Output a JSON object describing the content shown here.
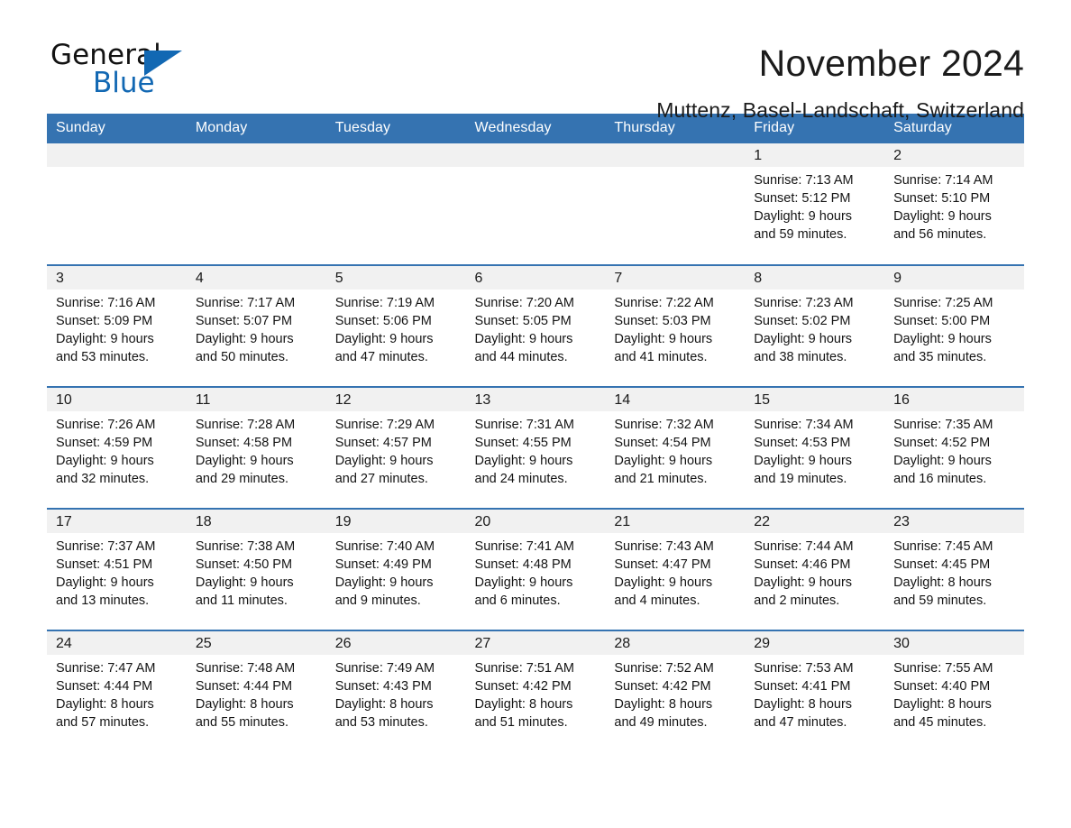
{
  "logo": {
    "word1": "General",
    "word2": "Blue",
    "triangle_color": "#1268b3"
  },
  "header": {
    "month_title": "November 2024",
    "location": "Muttenz, Basel-Landschaft, Switzerland"
  },
  "theme": {
    "header_blue": "#3573b1",
    "daynum_band": "#f1f1f1",
    "text": "#141414"
  },
  "calendar": {
    "weekday_headers": [
      "Sunday",
      "Monday",
      "Tuesday",
      "Wednesday",
      "Thursday",
      "Friday",
      "Saturday"
    ],
    "weeks": [
      [
        {
          "day": "",
          "sunrise": "",
          "sunset": "",
          "daylight_line1": "",
          "daylight_line2": ""
        },
        {
          "day": "",
          "sunrise": "",
          "sunset": "",
          "daylight_line1": "",
          "daylight_line2": ""
        },
        {
          "day": "",
          "sunrise": "",
          "sunset": "",
          "daylight_line1": "",
          "daylight_line2": ""
        },
        {
          "day": "",
          "sunrise": "",
          "sunset": "",
          "daylight_line1": "",
          "daylight_line2": ""
        },
        {
          "day": "",
          "sunrise": "",
          "sunset": "",
          "daylight_line1": "",
          "daylight_line2": ""
        },
        {
          "day": "1",
          "sunrise": "Sunrise: 7:13 AM",
          "sunset": "Sunset: 5:12 PM",
          "daylight_line1": "Daylight: 9 hours",
          "daylight_line2": "and 59 minutes."
        },
        {
          "day": "2",
          "sunrise": "Sunrise: 7:14 AM",
          "sunset": "Sunset: 5:10 PM",
          "daylight_line1": "Daylight: 9 hours",
          "daylight_line2": "and 56 minutes."
        }
      ],
      [
        {
          "day": "3",
          "sunrise": "Sunrise: 7:16 AM",
          "sunset": "Sunset: 5:09 PM",
          "daylight_line1": "Daylight: 9 hours",
          "daylight_line2": "and 53 minutes."
        },
        {
          "day": "4",
          "sunrise": "Sunrise: 7:17 AM",
          "sunset": "Sunset: 5:07 PM",
          "daylight_line1": "Daylight: 9 hours",
          "daylight_line2": "and 50 minutes."
        },
        {
          "day": "5",
          "sunrise": "Sunrise: 7:19 AM",
          "sunset": "Sunset: 5:06 PM",
          "daylight_line1": "Daylight: 9 hours",
          "daylight_line2": "and 47 minutes."
        },
        {
          "day": "6",
          "sunrise": "Sunrise: 7:20 AM",
          "sunset": "Sunset: 5:05 PM",
          "daylight_line1": "Daylight: 9 hours",
          "daylight_line2": "and 44 minutes."
        },
        {
          "day": "7",
          "sunrise": "Sunrise: 7:22 AM",
          "sunset": "Sunset: 5:03 PM",
          "daylight_line1": "Daylight: 9 hours",
          "daylight_line2": "and 41 minutes."
        },
        {
          "day": "8",
          "sunrise": "Sunrise: 7:23 AM",
          "sunset": "Sunset: 5:02 PM",
          "daylight_line1": "Daylight: 9 hours",
          "daylight_line2": "and 38 minutes."
        },
        {
          "day": "9",
          "sunrise": "Sunrise: 7:25 AM",
          "sunset": "Sunset: 5:00 PM",
          "daylight_line1": "Daylight: 9 hours",
          "daylight_line2": "and 35 minutes."
        }
      ],
      [
        {
          "day": "10",
          "sunrise": "Sunrise: 7:26 AM",
          "sunset": "Sunset: 4:59 PM",
          "daylight_line1": "Daylight: 9 hours",
          "daylight_line2": "and 32 minutes."
        },
        {
          "day": "11",
          "sunrise": "Sunrise: 7:28 AM",
          "sunset": "Sunset: 4:58 PM",
          "daylight_line1": "Daylight: 9 hours",
          "daylight_line2": "and 29 minutes."
        },
        {
          "day": "12",
          "sunrise": "Sunrise: 7:29 AM",
          "sunset": "Sunset: 4:57 PM",
          "daylight_line1": "Daylight: 9 hours",
          "daylight_line2": "and 27 minutes."
        },
        {
          "day": "13",
          "sunrise": "Sunrise: 7:31 AM",
          "sunset": "Sunset: 4:55 PM",
          "daylight_line1": "Daylight: 9 hours",
          "daylight_line2": "and 24 minutes."
        },
        {
          "day": "14",
          "sunrise": "Sunrise: 7:32 AM",
          "sunset": "Sunset: 4:54 PM",
          "daylight_line1": "Daylight: 9 hours",
          "daylight_line2": "and 21 minutes."
        },
        {
          "day": "15",
          "sunrise": "Sunrise: 7:34 AM",
          "sunset": "Sunset: 4:53 PM",
          "daylight_line1": "Daylight: 9 hours",
          "daylight_line2": "and 19 minutes."
        },
        {
          "day": "16",
          "sunrise": "Sunrise: 7:35 AM",
          "sunset": "Sunset: 4:52 PM",
          "daylight_line1": "Daylight: 9 hours",
          "daylight_line2": "and 16 minutes."
        }
      ],
      [
        {
          "day": "17",
          "sunrise": "Sunrise: 7:37 AM",
          "sunset": "Sunset: 4:51 PM",
          "daylight_line1": "Daylight: 9 hours",
          "daylight_line2": "and 13 minutes."
        },
        {
          "day": "18",
          "sunrise": "Sunrise: 7:38 AM",
          "sunset": "Sunset: 4:50 PM",
          "daylight_line1": "Daylight: 9 hours",
          "daylight_line2": "and 11 minutes."
        },
        {
          "day": "19",
          "sunrise": "Sunrise: 7:40 AM",
          "sunset": "Sunset: 4:49 PM",
          "daylight_line1": "Daylight: 9 hours",
          "daylight_line2": "and 9 minutes."
        },
        {
          "day": "20",
          "sunrise": "Sunrise: 7:41 AM",
          "sunset": "Sunset: 4:48 PM",
          "daylight_line1": "Daylight: 9 hours",
          "daylight_line2": "and 6 minutes."
        },
        {
          "day": "21",
          "sunrise": "Sunrise: 7:43 AM",
          "sunset": "Sunset: 4:47 PM",
          "daylight_line1": "Daylight: 9 hours",
          "daylight_line2": "and 4 minutes."
        },
        {
          "day": "22",
          "sunrise": "Sunrise: 7:44 AM",
          "sunset": "Sunset: 4:46 PM",
          "daylight_line1": "Daylight: 9 hours",
          "daylight_line2": "and 2 minutes."
        },
        {
          "day": "23",
          "sunrise": "Sunrise: 7:45 AM",
          "sunset": "Sunset: 4:45 PM",
          "daylight_line1": "Daylight: 8 hours",
          "daylight_line2": "and 59 minutes."
        }
      ],
      [
        {
          "day": "24",
          "sunrise": "Sunrise: 7:47 AM",
          "sunset": "Sunset: 4:44 PM",
          "daylight_line1": "Daylight: 8 hours",
          "daylight_line2": "and 57 minutes."
        },
        {
          "day": "25",
          "sunrise": "Sunrise: 7:48 AM",
          "sunset": "Sunset: 4:44 PM",
          "daylight_line1": "Daylight: 8 hours",
          "daylight_line2": "and 55 minutes."
        },
        {
          "day": "26",
          "sunrise": "Sunrise: 7:49 AM",
          "sunset": "Sunset: 4:43 PM",
          "daylight_line1": "Daylight: 8 hours",
          "daylight_line2": "and 53 minutes."
        },
        {
          "day": "27",
          "sunrise": "Sunrise: 7:51 AM",
          "sunset": "Sunset: 4:42 PM",
          "daylight_line1": "Daylight: 8 hours",
          "daylight_line2": "and 51 minutes."
        },
        {
          "day": "28",
          "sunrise": "Sunrise: 7:52 AM",
          "sunset": "Sunset: 4:42 PM",
          "daylight_line1": "Daylight: 8 hours",
          "daylight_line2": "and 49 minutes."
        },
        {
          "day": "29",
          "sunrise": "Sunrise: 7:53 AM",
          "sunset": "Sunset: 4:41 PM",
          "daylight_line1": "Daylight: 8 hours",
          "daylight_line2": "and 47 minutes."
        },
        {
          "day": "30",
          "sunrise": "Sunrise: 7:55 AM",
          "sunset": "Sunset: 4:40 PM",
          "daylight_line1": "Daylight: 8 hours",
          "daylight_line2": "and 45 minutes."
        }
      ]
    ]
  }
}
